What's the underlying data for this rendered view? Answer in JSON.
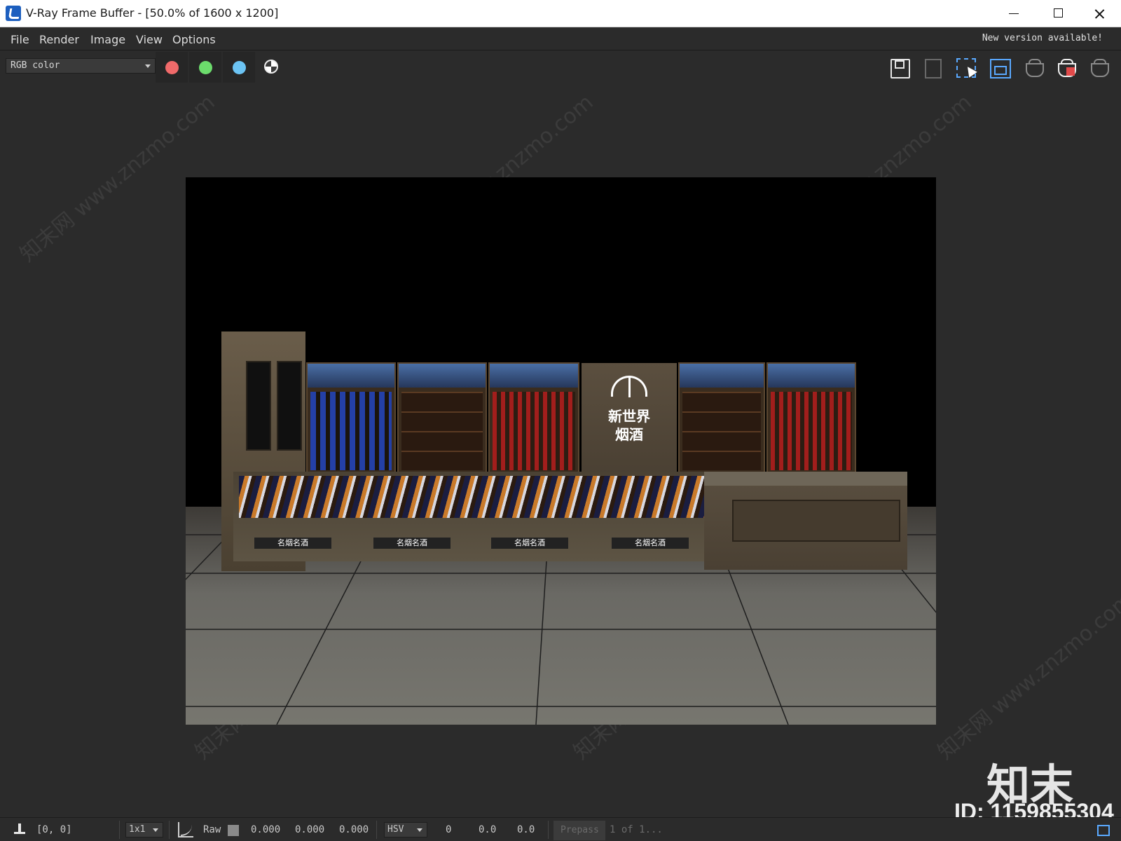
{
  "window": {
    "title": "V-Ray Frame Buffer - [50.0% of 1600 x 1200]"
  },
  "menu": {
    "items": [
      "File",
      "Render",
      "Image",
      "View",
      "Options"
    ],
    "notice": "New version available!"
  },
  "toolbar": {
    "channel": "RGB color",
    "channel_buttons": [
      {
        "name": "red",
        "color": "#f06a6a"
      },
      {
        "name": "green",
        "color": "#6cdc6c"
      },
      {
        "name": "blue",
        "color": "#6cc4f4"
      }
    ],
    "right_icons": [
      "save-icon",
      "clear-icon",
      "region-render-icon",
      "track-mouse-icon",
      "render-last-icon",
      "stop-render-icon",
      "render-icon"
    ]
  },
  "render_scene": {
    "store_name_line1": "新世界",
    "store_name_line2": "烟酒",
    "counter_signs": [
      "名烟名酒",
      "名烟名酒",
      "名烟名酒",
      "名烟名酒"
    ]
  },
  "watermark": {
    "repeated_text": "知末网 www.znzmo.com",
    "logo": "知末",
    "id": "ID: 1159855304"
  },
  "statusbar": {
    "coords": "[0, 0]",
    "zoom": "1x1",
    "mode": "Raw",
    "rgb_values": [
      "0.000",
      "0.000",
      "0.000"
    ],
    "color_space": "HSV",
    "hsv_values": [
      "0",
      "0.0",
      "0.0"
    ],
    "prepass_label": "Prepass",
    "progress": "1 of 1..."
  }
}
